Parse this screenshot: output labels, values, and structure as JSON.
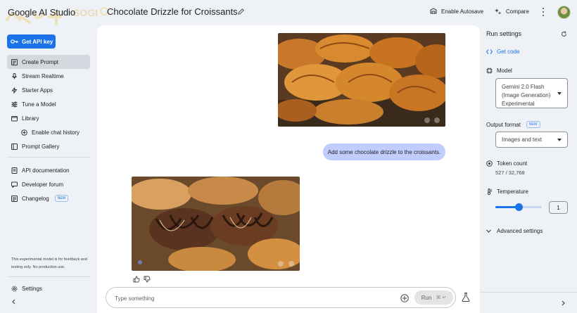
{
  "header": {
    "brand": "Google AI Studio",
    "watermark_text": "SOGI",
    "prompt_title": "Chocolate Drizzle for Croissants",
    "enable_autosave": "Enable Autosave",
    "compare": "Compare"
  },
  "sidebar": {
    "api_key_label": "Get API key",
    "items": [
      {
        "label": "Create Prompt",
        "icon": "create-prompt-icon"
      },
      {
        "label": "Stream Realtime",
        "icon": "microphone-icon"
      },
      {
        "label": "Starter Apps",
        "icon": "bolt-icon"
      },
      {
        "label": "Tune a Model",
        "icon": "tune-icon"
      },
      {
        "label": "Library",
        "icon": "library-icon"
      },
      {
        "label": "Enable chat history",
        "icon": "add-history-icon"
      },
      {
        "label": "Prompt Gallery",
        "icon": "gallery-icon"
      }
    ],
    "links": [
      {
        "label": "API documentation",
        "icon": "documentation-icon"
      },
      {
        "label": "Developer forum",
        "icon": "forum-icon"
      },
      {
        "label": "Changelog",
        "icon": "changelog-icon",
        "badge": "NEW"
      }
    ],
    "disclaimer": "This experimental model is for feedback and testing only. No production use.",
    "settings_label": "Settings"
  },
  "chat": {
    "user_message": "Add some chocolate drizzle to the croissants.",
    "input_placeholder": "Type something",
    "run_label": "Run",
    "run_shortcut": "⌘ ↵"
  },
  "run_settings": {
    "title": "Run settings",
    "get_code": "Get code",
    "model_label": "Model",
    "model_value": [
      "Gemini 2.0 Flash",
      "(Image Generation)",
      "Experimental"
    ],
    "output_format_label": "Output format",
    "output_format_badge": "NEW",
    "output_format_value": "Images and text",
    "token_count_label": "Token count",
    "token_count_value": "527 / 32,768",
    "temperature_label": "Temperature",
    "temperature_value": "1",
    "temperature_fraction": 0.5,
    "advanced_settings": "Advanced settings"
  },
  "colors": {
    "accent": "#1a73e8",
    "user_bubble": "#c2cdff",
    "page_bg": "#eef1f6"
  }
}
